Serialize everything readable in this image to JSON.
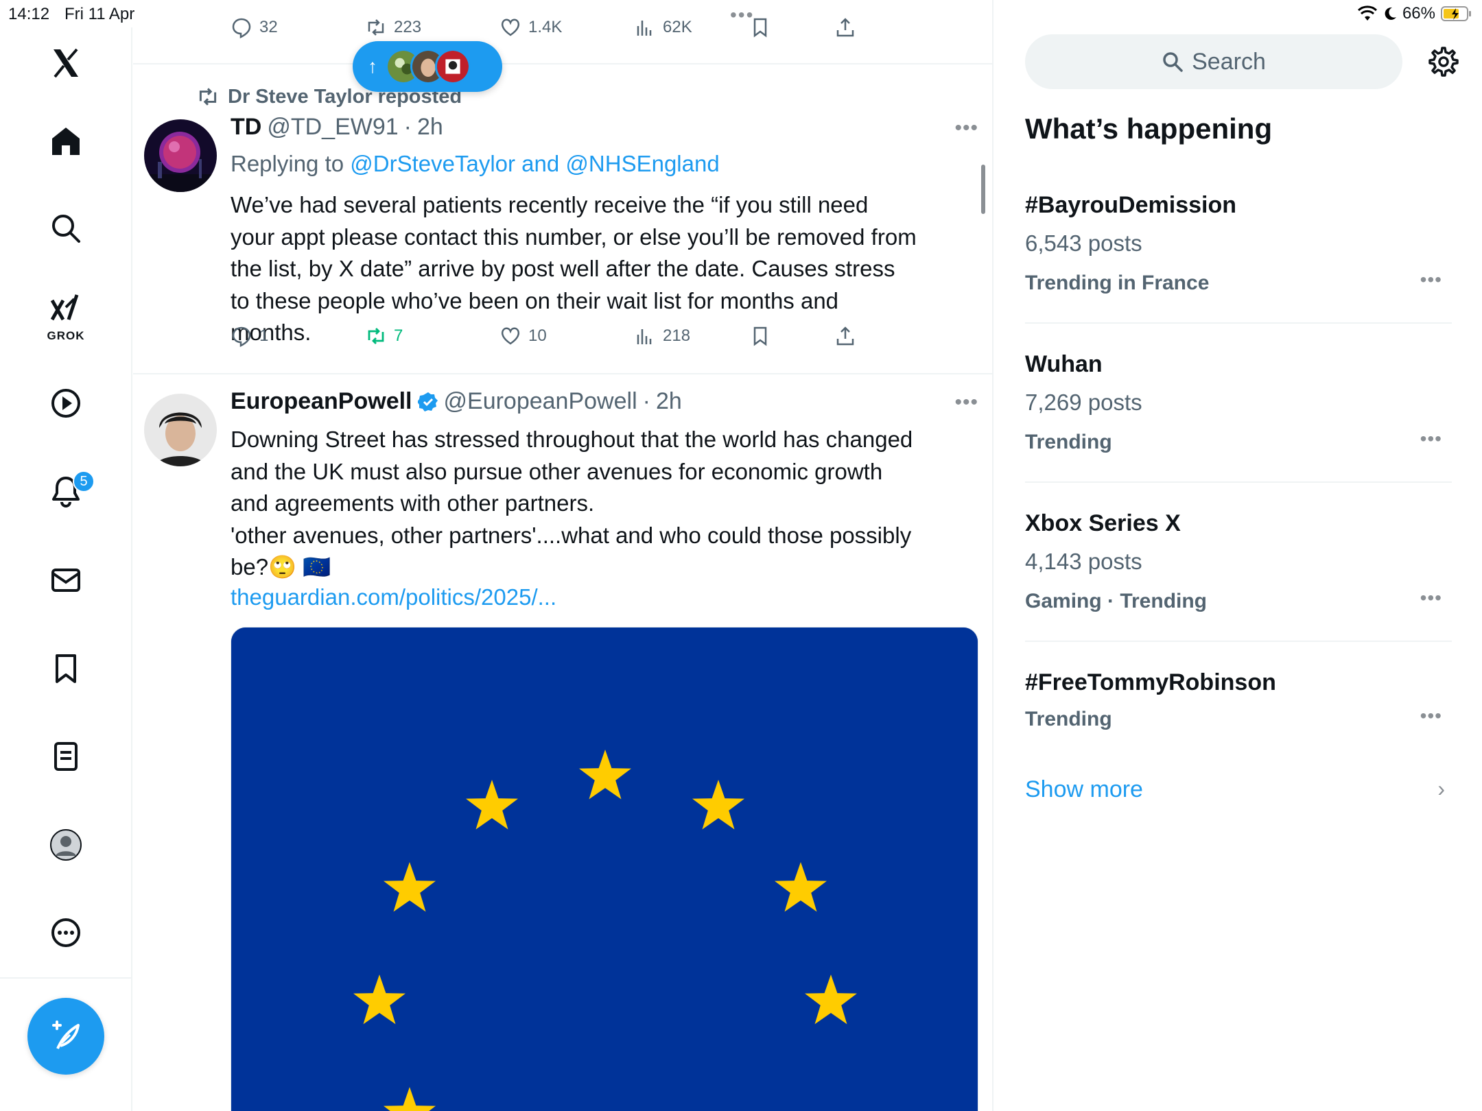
{
  "status_bar": {
    "time": "14:12",
    "date": "Fri 11 Apr",
    "battery": "66%"
  },
  "sidebar": {
    "grok_label": "GROK",
    "notification_count": "5",
    "icons": [
      "x-logo-icon",
      "home-icon",
      "search-icon",
      "grok-icon",
      "video-icon",
      "bell-icon",
      "mail-icon",
      "bookmark-icon",
      "list-icon",
      "profile-icon",
      "more-icon",
      "compose-icon"
    ]
  },
  "timeline": {
    "prev_tweet_actions": {
      "replies": "32",
      "reposts": "223",
      "likes": "1.4K",
      "views": "62K"
    },
    "tweet1": {
      "repost_label": "Dr Steve Taylor reposted",
      "name": "TD",
      "handle": "@TD_EW91",
      "time": "2h",
      "replying_prefix": "Replying to",
      "replying_to": "@DrSteveTaylor and @NHSEngland",
      "text": "We’ve had several patients recently receive the “if you still need your appt please contact this number, or else you’ll be removed from the list, by X date” arrive by post well after the date. Causes stress to these people who’ve been on their wait list for months and months.",
      "replies": "1",
      "reposts": "7",
      "likes": "10",
      "views": "218"
    },
    "tweet2": {
      "name": "EuropeanPowell",
      "handle": "@EuropeanPowell",
      "time": "2h",
      "text_line1": "Downing Street has stressed throughout that the world has changed and the UK must also pursue other avenues for economic growth and agreements with other partners.",
      "text_line2": "'other avenues, other partners'....what and who could those possibly be?🙄 🇪🇺",
      "link": "theguardian.com/politics/2025/...",
      "media_alt": "EU flag"
    }
  },
  "right": {
    "search_placeholder": "Search",
    "whats_happening": "What’s happening",
    "trends": [
      {
        "name": "#BayrouDemission",
        "posts": "6,543 posts",
        "context": "Trending in France"
      },
      {
        "name": "Wuhan",
        "posts": "7,269 posts",
        "context": "Trending"
      },
      {
        "name": "Xbox Series X",
        "posts": "4,143 posts",
        "context": "Gaming · Trending"
      },
      {
        "name": "#FreeTommyRobinson",
        "posts": "",
        "context": "Trending"
      }
    ],
    "show_more": "Show more"
  },
  "colors": {
    "accent": "#1d9bf0",
    "repost_green": "#00ba7c",
    "secondary_text": "#536471",
    "eu_blue": "#003399",
    "eu_star": "#ffcc00"
  }
}
